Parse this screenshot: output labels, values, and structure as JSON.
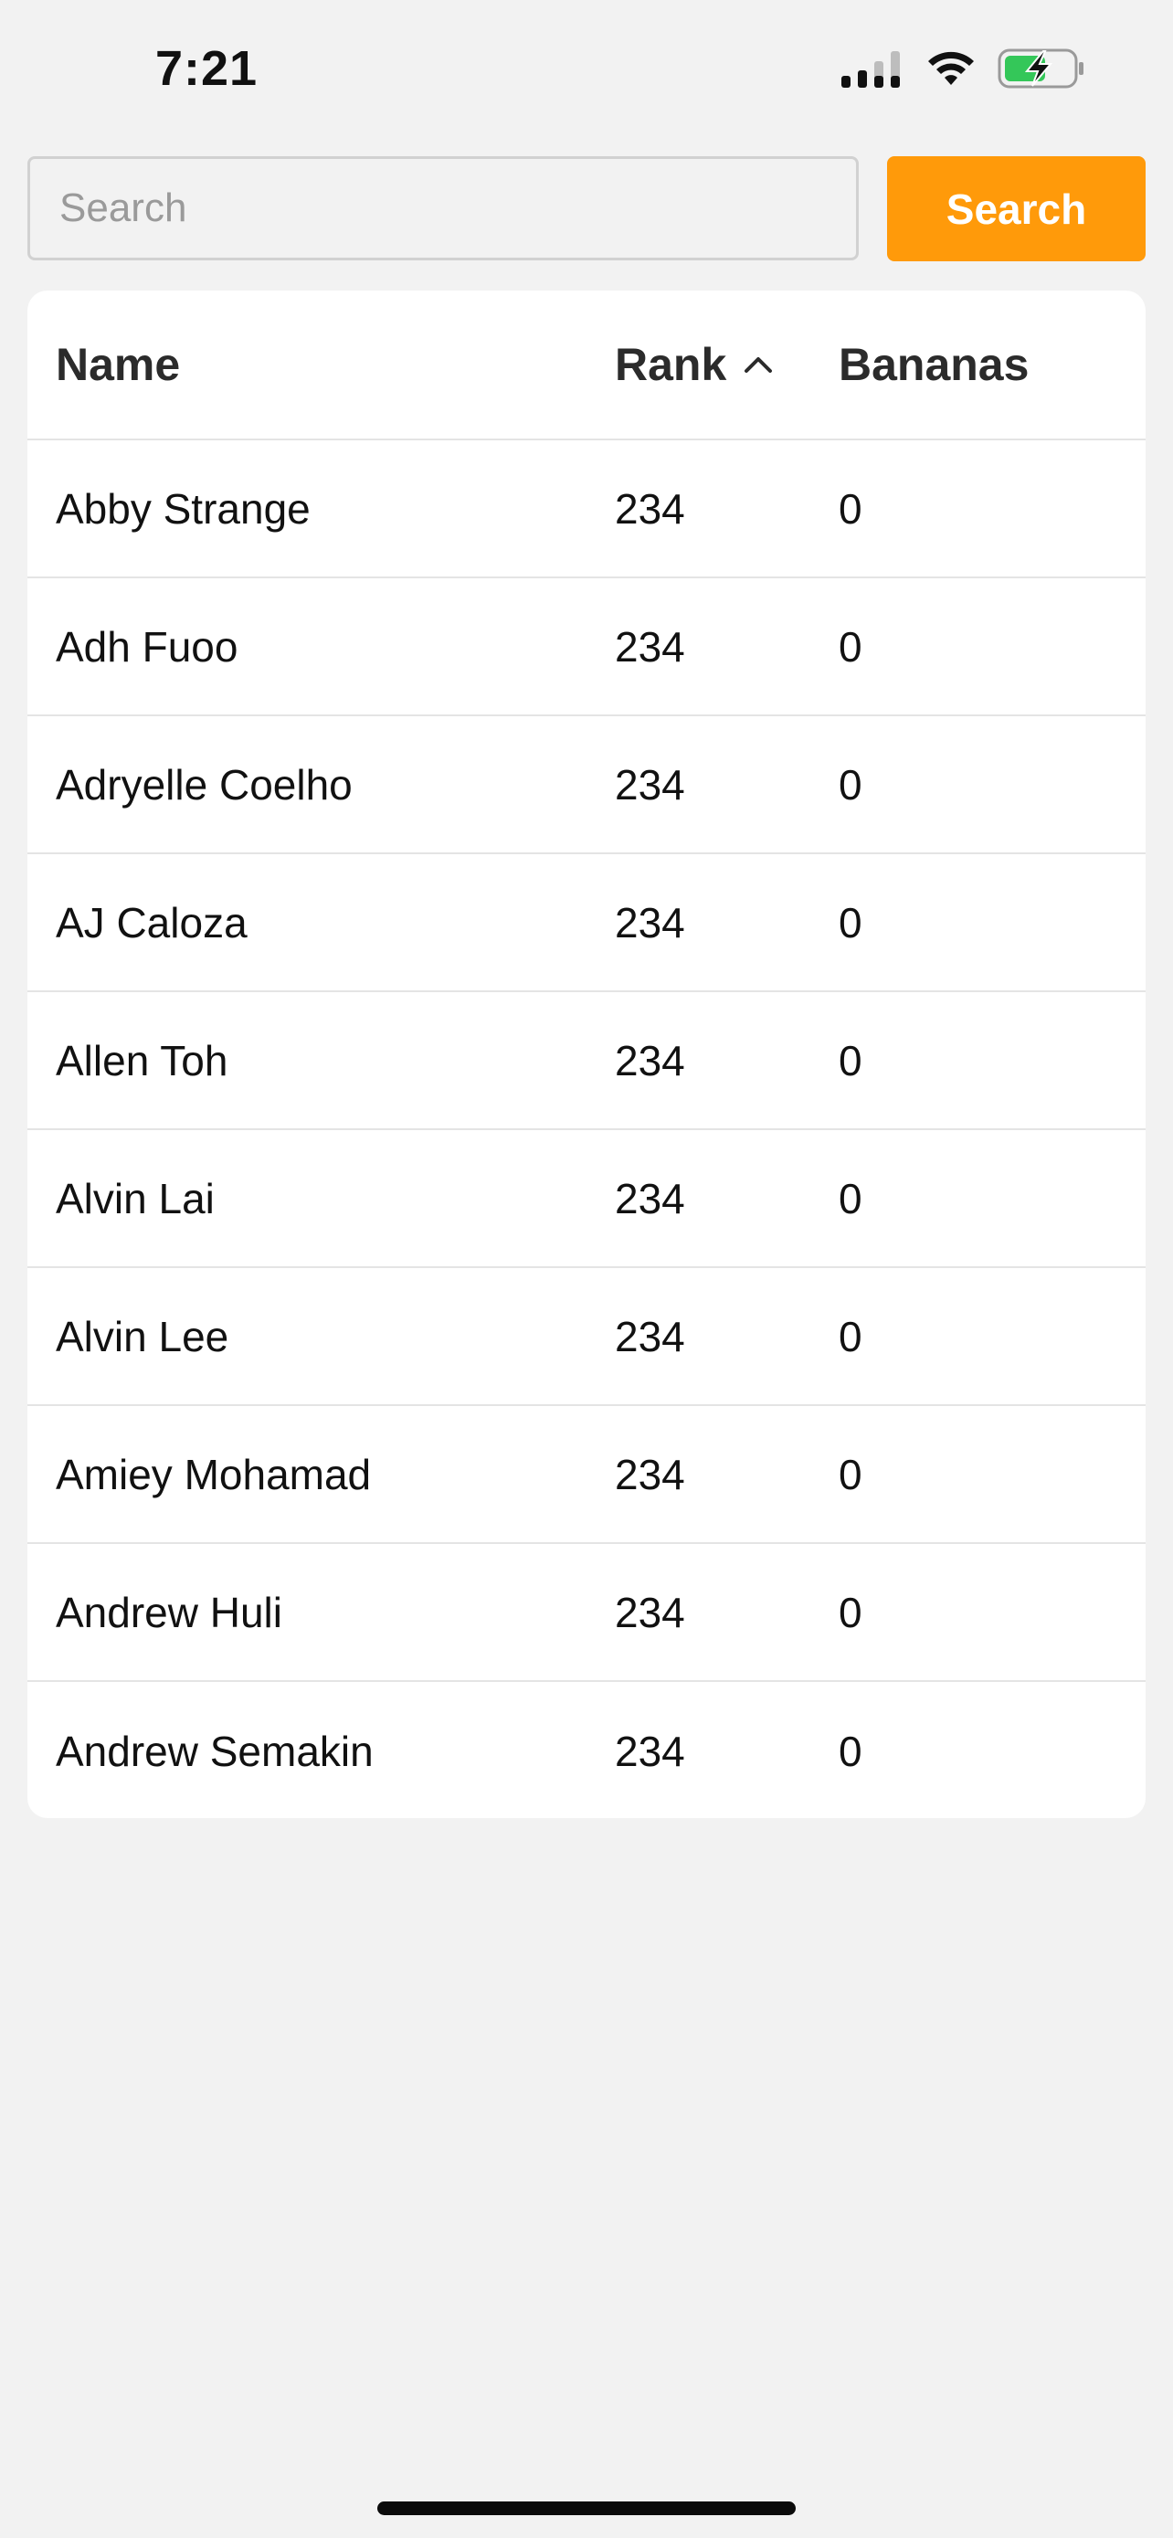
{
  "status_bar": {
    "time": "7:21"
  },
  "search": {
    "placeholder": "Search",
    "value": "",
    "button_label": "Search"
  },
  "colors": {
    "accent": "#ff9a0a",
    "background": "#f2f2f2",
    "card": "#ffffff",
    "battery_fill": "#34c759"
  },
  "table": {
    "headers": {
      "name": "Name",
      "rank": "Rank",
      "bananas": "Bananas"
    },
    "sort": {
      "column": "rank",
      "direction": "ascending",
      "icon": "chevron-up-icon"
    },
    "rows": [
      {
        "name": "Abby Strange",
        "rank": "234",
        "bananas": "0"
      },
      {
        "name": "Adh Fuoo",
        "rank": "234",
        "bananas": "0"
      },
      {
        "name": "Adryelle Coelho",
        "rank": "234",
        "bananas": "0"
      },
      {
        "name": "AJ Caloza",
        "rank": "234",
        "bananas": "0"
      },
      {
        "name": "Allen Toh",
        "rank": "234",
        "bananas": "0"
      },
      {
        "name": "Alvin Lai",
        "rank": "234",
        "bananas": "0"
      },
      {
        "name": "Alvin Lee",
        "rank": "234",
        "bananas": "0"
      },
      {
        "name": "Amiey Mohamad",
        "rank": "234",
        "bananas": "0"
      },
      {
        "name": "Andrew Huli",
        "rank": "234",
        "bananas": "0"
      },
      {
        "name": "Andrew Semakin",
        "rank": "234",
        "bananas": "0"
      }
    ]
  }
}
